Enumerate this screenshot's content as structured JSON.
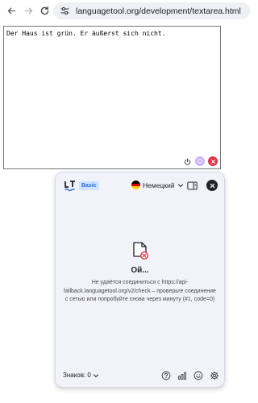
{
  "browser": {
    "url": "languagetool.org/development/textarea.html",
    "icons": [
      "back-arrow-icon",
      "forward-arrow-icon",
      "reload-icon",
      "site-settings-icon"
    ]
  },
  "textarea": {
    "value": "Der Haus ist grün. Er äußerst sich nicht."
  },
  "panel": {
    "plan_badge": "Basic",
    "language": "Немецкий",
    "error": {
      "title": "Ой...",
      "message": "Не удаётся соединиться с https://api-fallback.languagetool.org/v2/check – проверьте соединение с сетью или попробуйте снова через минуту (#1, code=0)"
    },
    "footer": {
      "char_count": "Знаков: 0"
    }
  },
  "colors": {
    "accent": "#2a6ad4",
    "error": "#e3344a",
    "panel_bg": "#f1f3f8",
    "badge_bg": "#cfe3ff"
  }
}
